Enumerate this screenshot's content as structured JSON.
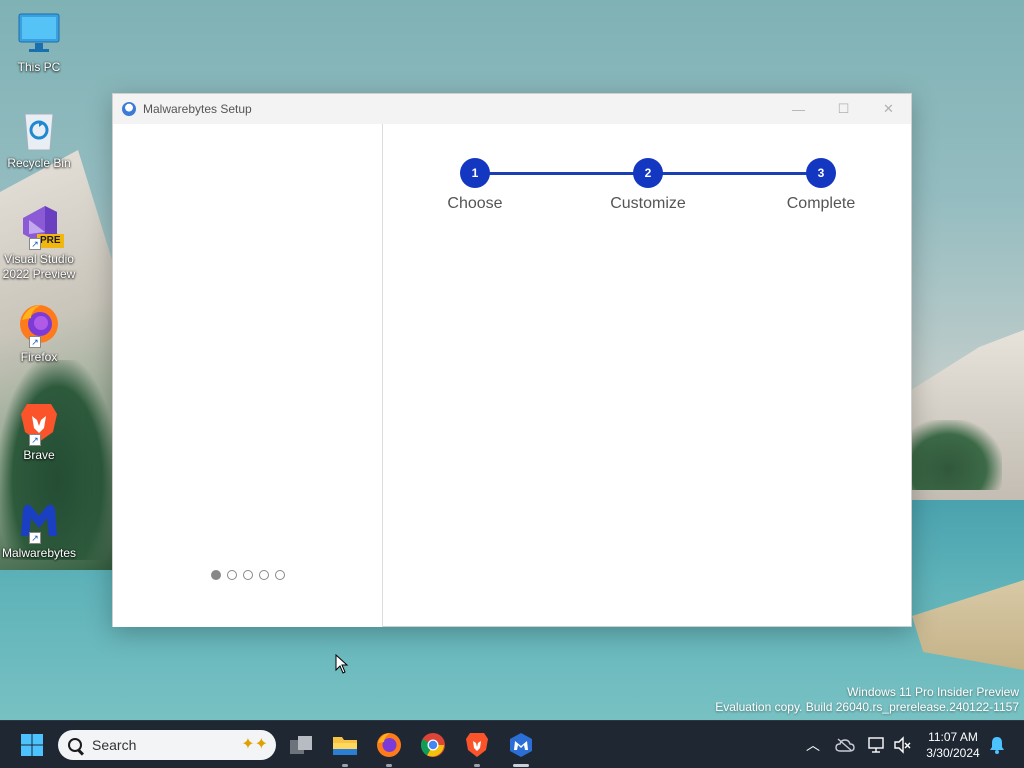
{
  "desktop": {
    "icons": [
      {
        "label": "This PC"
      },
      {
        "label": "Recycle Bin"
      },
      {
        "label": "Visual Studio 2022 Preview",
        "badge": "PRE"
      },
      {
        "label": "Firefox"
      },
      {
        "label": "Brave"
      },
      {
        "label": "Malwarebytes"
      }
    ],
    "watermark": {
      "line1": "Windows 11 Pro Insider Preview",
      "line2": "Evaluation copy. Build 26040.rs_prerelease.240122-1157"
    }
  },
  "window": {
    "title": "Malwarebytes Setup",
    "controls": {
      "minimize": "—",
      "maximize": "☐",
      "close": "✕"
    },
    "steps": [
      {
        "number": "1",
        "label": "Choose"
      },
      {
        "number": "2",
        "label": "Customize"
      },
      {
        "number": "3",
        "label": "Complete"
      }
    ],
    "carousel": {
      "total": 5,
      "active_index": 0
    },
    "accent_color": "#1437c2"
  },
  "taskbar": {
    "search_placeholder": "Search",
    "apps": [
      "start-icon",
      "task-view-icon",
      "file-explorer-icon",
      "firefox-icon",
      "chrome-icon",
      "brave-icon",
      "malwarebytes-icon"
    ],
    "tray_icons": [
      "chevron-up-icon",
      "onedrive-icon",
      "network-icon",
      "volume-icon",
      "notification-bell-icon"
    ],
    "clock": {
      "time": "11:07 AM",
      "date": "3/30/2024"
    }
  }
}
